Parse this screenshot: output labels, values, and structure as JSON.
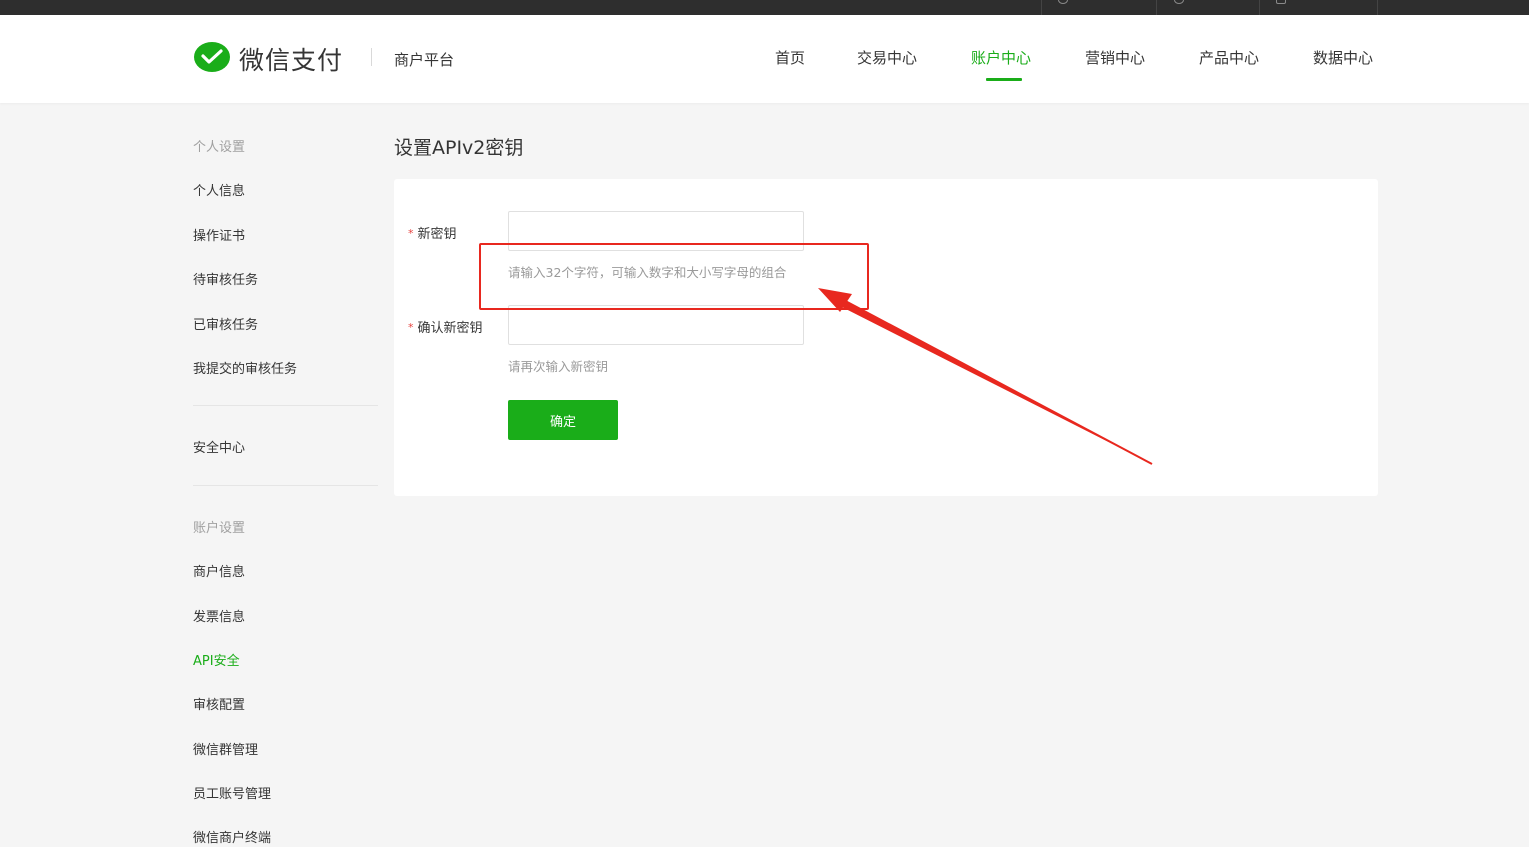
{
  "header": {
    "brand": "微信支付",
    "platform": "商户平台",
    "nav": [
      {
        "label": "首页",
        "active": false
      },
      {
        "label": "交易中心",
        "active": false
      },
      {
        "label": "账户中心",
        "active": true
      },
      {
        "label": "营销中心",
        "active": false
      },
      {
        "label": "产品中心",
        "active": false
      },
      {
        "label": "数据中心",
        "active": false
      }
    ]
  },
  "sidebar": {
    "personal_title": "个人设置",
    "personal_items": [
      "个人信息",
      "操作证书",
      "待审核任务",
      "已审核任务",
      "我提交的审核任务"
    ],
    "security": "安全中心",
    "account_title": "账户设置",
    "account_items": [
      "商户信息",
      "发票信息",
      "API安全",
      "审核配置",
      "微信群管理",
      "员工账号管理",
      "微信商户终端"
    ],
    "active_item": "API安全"
  },
  "main": {
    "title": "设置APIv2密钥",
    "form": {
      "new_key_label": "新密钥",
      "new_key_hint": "请输入32个字符，可输入数字和大小写字母的组合",
      "confirm_key_label": "确认新密钥",
      "confirm_key_hint": "请再次输入新密钥",
      "required_mark": "*",
      "submit_label": "确定"
    }
  },
  "annotation": {
    "highlight_color": "#e8281f"
  },
  "colors": {
    "accent": "#1aad19",
    "required": "#e64340"
  }
}
